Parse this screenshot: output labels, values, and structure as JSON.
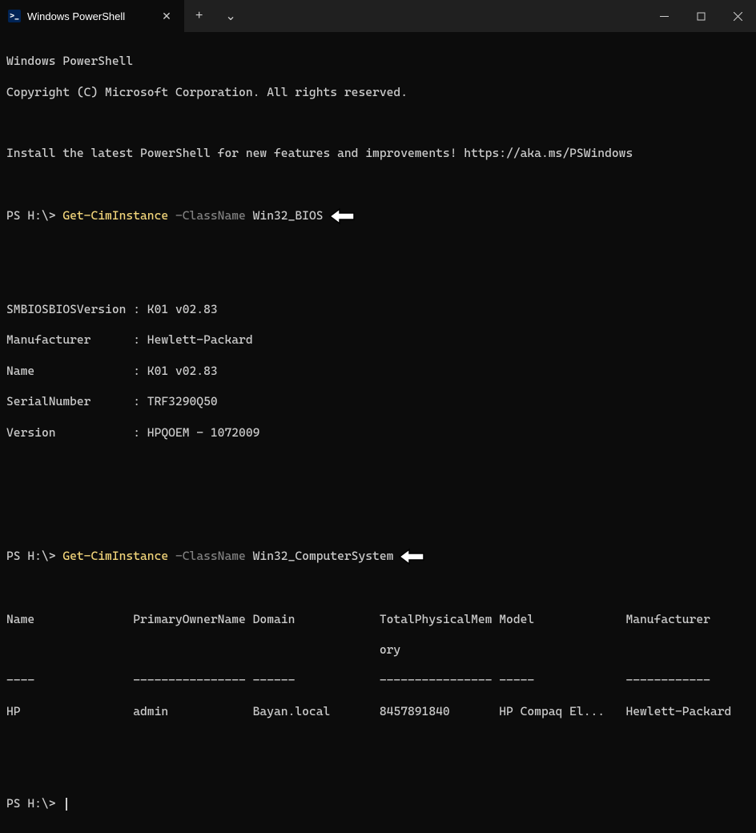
{
  "titlebar": {
    "tab_title": "Windows PowerShell",
    "new_tab": "+",
    "dropdown": "⌄"
  },
  "header": {
    "line1": "Windows PowerShell",
    "line2": "Copyright (C) Microsoft Corporation. All rights reserved.",
    "install_msg": "Install the latest PowerShell for new features and improvements! https://aka.ms/PSWindows"
  },
  "prompt": "PS H:\\> ",
  "cmd1": {
    "cmd": "Get-CimInstance",
    "param": " -ClassName",
    "arg": " Win32_BIOS"
  },
  "output1": {
    "l1": "SMBIOSBIOSVersion : K01 v02.83",
    "l2": "Manufacturer      : Hewlett-Packard",
    "l3": "Name              : K01 v02.83",
    "l4": "SerialNumber      : TRF3290Q50",
    "l5": "Version           : HPQOEM - 1072009"
  },
  "cmd2": {
    "cmd": "Get-CimInstance",
    "param": " -ClassName",
    "arg": " Win32_ComputerSystem"
  },
  "output2": {
    "hdr1": "Name              PrimaryOwnerName Domain            TotalPhysicalMem Model             Manufacturer",
    "hdr2": "                                                     ory",
    "sep": "----              ---------------- ------            ---------------- -----             ------------",
    "row": "HP                admin            Bayan.local       8457891840       HP Compaq El...   Hewlett-Packard"
  },
  "prompt_empty": "PS H:\\> "
}
